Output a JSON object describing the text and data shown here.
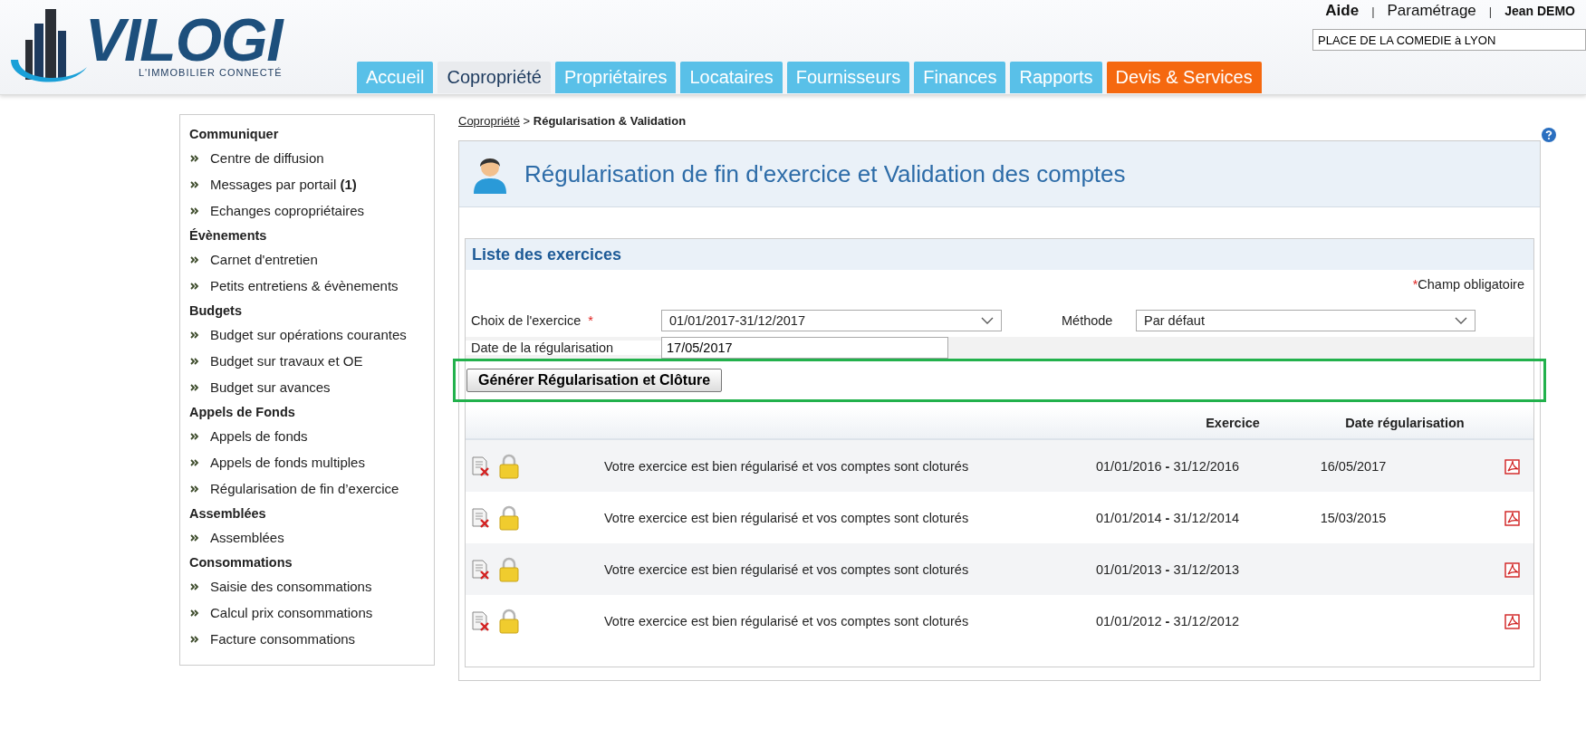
{
  "logo": {
    "name": "VILOGI",
    "tagline": "L'IMMOBILIER CONNECTÉ"
  },
  "top_links": [
    {
      "label": "Aide",
      "bold": true
    },
    {
      "label": "Paramétrage",
      "bold": false
    },
    {
      "label": "Jean DEMO",
      "bold": true
    }
  ],
  "top_separators": [
    "|",
    "|"
  ],
  "residence_field": {
    "value": "PLACE DE LA COMEDIE à LYON"
  },
  "tabs": [
    {
      "label": "Accueil",
      "selected": false,
      "kind": "standard"
    },
    {
      "label": "Copropriété",
      "selected": true,
      "kind": "standard"
    },
    {
      "label": "Propriétaires",
      "selected": false,
      "kind": "standard"
    },
    {
      "label": "Locataires",
      "selected": false,
      "kind": "standard"
    },
    {
      "label": "Fournisseurs",
      "selected": false,
      "kind": "standard"
    },
    {
      "label": "Finances",
      "selected": false,
      "kind": "standard"
    },
    {
      "label": "Rapports",
      "selected": false,
      "kind": "standard"
    },
    {
      "label": "Devis & Services",
      "selected": false,
      "kind": "promo"
    }
  ],
  "sidebar": {
    "sections": [
      {
        "title": "Communiquer",
        "items": [
          "Centre de diffusion",
          "Messages par portail **(1)**",
          "Echanges copropriétaires"
        ]
      },
      {
        "title": "Évènements",
        "items": [
          "Carnet d'entretien",
          "Petits entretiens & évènements"
        ]
      },
      {
        "title": "Budgets",
        "items": [
          "Budget sur opérations courantes",
          "Budget sur travaux et OE",
          "Budget sur avances"
        ]
      },
      {
        "title": "Appels de Fonds",
        "items": [
          "Appels de fonds",
          "Appels de fonds multiples",
          "Régularisation de fin d’exercice"
        ]
      },
      {
        "title": "Assemblées",
        "items": [
          "Assemblées"
        ]
      },
      {
        "title": "Consommations",
        "items": [
          "Saisie des consommations",
          "Calcul prix consommations",
          "Facture consommations"
        ]
      }
    ]
  },
  "breadcrumb": {
    "link": "Copropriété",
    "separator": ">",
    "current": "Régularisation & Validation"
  },
  "page_title": "Régularisation de fin d'exercice et Validation des comptes",
  "panel": {
    "title": "Liste des exercices",
    "required_note": {
      "mark": "*",
      "text": "Champ obligatoire"
    },
    "exercise_select": {
      "label": "Choix de l'exercice",
      "required_mark": "*",
      "value": "01/01/2017-31/12/2017"
    },
    "method_select": {
      "label": "Méthode",
      "value": "Par défaut"
    },
    "date_field": {
      "label": "Date de la régularisation",
      "value": "17/05/2017"
    },
    "generate_button": "Générer Régularisation et Clôture",
    "table": {
      "columns": [
        "Exercice",
        "Date régularisation"
      ],
      "rows": [
        {
          "status": "Votre exercice est bien régularisé et vos comptes sont cloturés",
          "exercise": "01/01/2016 **-** 31/12/2016",
          "date": "16/05/2017"
        },
        {
          "status": "Votre exercice est bien régularisé et vos comptes sont cloturés",
          "exercise": "01/01/2014 **-** 31/12/2014",
          "date": "15/03/2015"
        },
        {
          "status": "Votre exercice est bien régularisé et vos comptes sont cloturés",
          "exercise": "01/01/2013 **-** 31/12/2013"
        },
        {
          "status": "Votre exercice est bien régularisé et vos comptes sont cloturés",
          "exercise": "01/01/2012 **-** 31/12/2012"
        }
      ]
    }
  }
}
